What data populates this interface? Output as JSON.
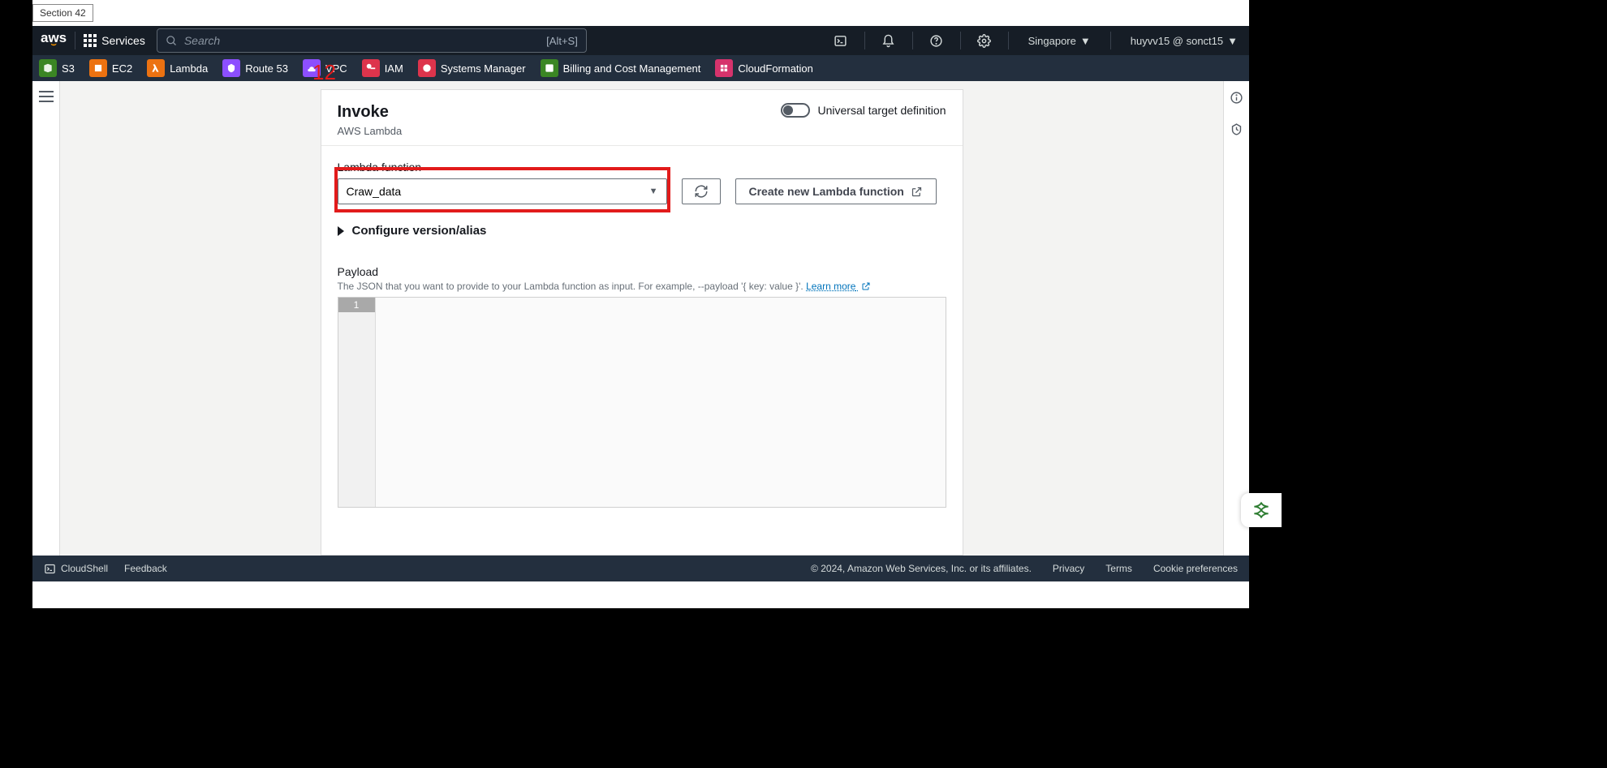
{
  "section_label": "Section 42",
  "topnav": {
    "services_label": "Services",
    "search_placeholder": "Search",
    "search_hint": "[Alt+S]",
    "region": "Singapore",
    "account": "huyvv15 @ sonct15"
  },
  "shortcuts": {
    "s3": "S3",
    "ec2": "EC2",
    "lambda": "Lambda",
    "r53": "Route 53",
    "vpc": "VPC",
    "iam": "IAM",
    "sm": "Systems Manager",
    "bill": "Billing and Cost Management",
    "cfn": "CloudFormation"
  },
  "panel": {
    "title": "Invoke",
    "subtitle": "AWS Lambda",
    "toggle_label": "Universal target definition",
    "lambda_label": "Lambda function",
    "lambda_value": "Craw_data",
    "create_btn": "Create new Lambda function",
    "configure": "Configure version/alias",
    "payload_label": "Payload",
    "payload_desc": "The JSON that you want to provide to your Lambda function as input. For example, --payload '{ key: value }'. ",
    "learn_more": "Learn more",
    "line_no": "1",
    "annotation_num": "12"
  },
  "footer": {
    "cloudshell": "CloudShell",
    "feedback": "Feedback",
    "copyright": "© 2024, Amazon Web Services, Inc. or its affiliates.",
    "privacy": "Privacy",
    "terms": "Terms",
    "cookies": "Cookie preferences"
  }
}
